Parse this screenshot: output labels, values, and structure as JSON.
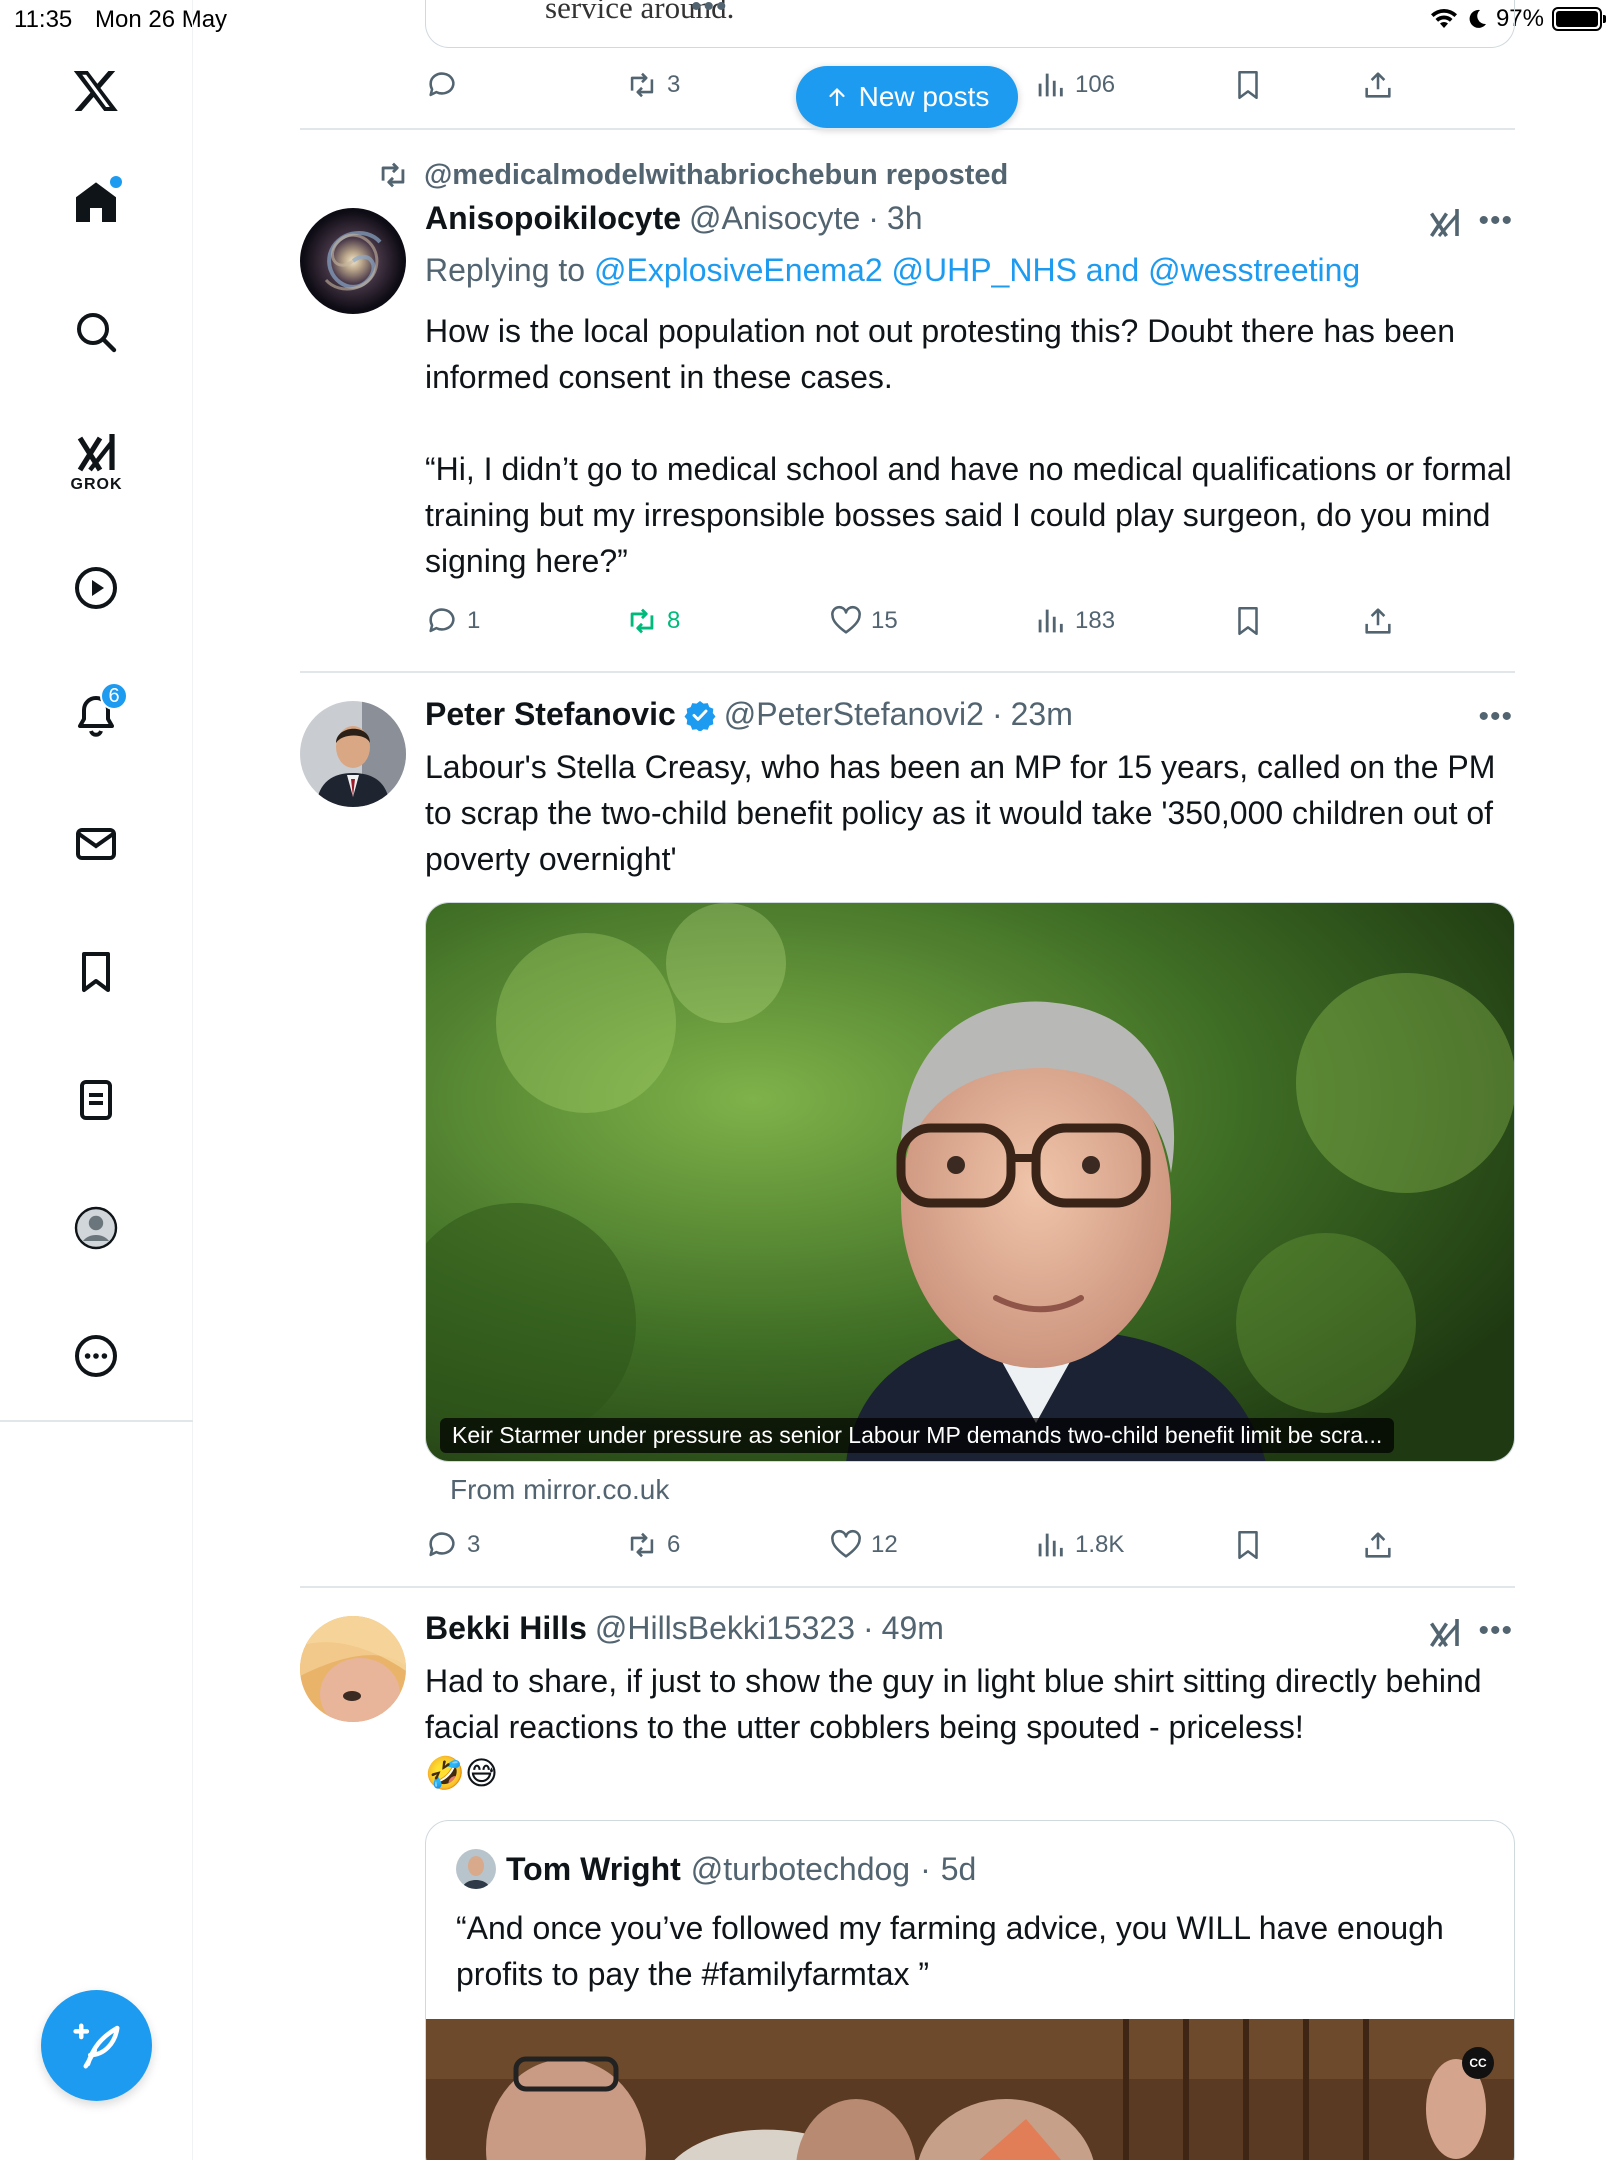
{
  "status_bar": {
    "time": "11:35",
    "date": "Mon 26 May",
    "battery": "97%"
  },
  "sidebar": {
    "items": [
      {
        "icon": "x-logo-icon"
      },
      {
        "icon": "home-icon",
        "has_dot": true
      },
      {
        "icon": "search-icon"
      },
      {
        "icon": "grok-icon",
        "label": "GROK"
      },
      {
        "icon": "video-play-icon"
      },
      {
        "icon": "notifications-bell-icon",
        "badge": "6"
      },
      {
        "icon": "messages-envelope-icon"
      },
      {
        "icon": "bookmarks-icon"
      },
      {
        "icon": "lists-icon"
      },
      {
        "icon": "profile-avatar-icon"
      },
      {
        "icon": "more-circle-icon"
      }
    ],
    "compose_icon": "compose-feather-icon"
  },
  "new_posts_pill": {
    "label": "New posts"
  },
  "top_card": {
    "text": "service around.",
    "dots": "•••",
    "actions": {
      "replies": "",
      "reposts": "3",
      "views": "106"
    }
  },
  "posts": [
    {
      "social_context": "@medicalmodelwithabriochebun reposted",
      "name": "Anisopoikilocyte",
      "handle": "@Anisocyte",
      "time": "3h",
      "replying_prefix": "Replying to",
      "replying_to": "@ExplosiveEnema2 @UHP_NHS and @wesstreeting",
      "text": "How is the local population not out protesting this? Doubt there has been informed consent in these cases.\n\n“Hi, I didn’t go to medical school and have no medical qualifications or formal training but my irresponsible bosses said I could play surgeon, do you mind signing here?”",
      "actions": {
        "replies": "1",
        "reposts": "8",
        "likes": "15",
        "views": "183"
      }
    },
    {
      "name": "Peter Stefanovic",
      "handle": "@PeterStefanovi2",
      "time": "23m",
      "text": "Labour's Stella Creasy, who has been an MP for 15 years, called on the PM to scrap the two-child benefit policy as it would take '350,000 children out of poverty overnight'",
      "media_caption": "Keir Starmer under pressure as senior Labour MP demands two-child benefit limit be scra...",
      "media_source": "From mirror.co.uk",
      "actions": {
        "replies": "3",
        "reposts": "6",
        "likes": "12",
        "views": "1.8K"
      }
    },
    {
      "name": "Bekki Hills",
      "handle": "@HillsBekki15323",
      "time": "49m",
      "text": "Had to share, if just to show the guy in light blue shirt sitting directly behind facial reactions to the utter cobblers being spouted - priceless!",
      "emoji": "🤣😅",
      "quote": {
        "name": "Tom Wright",
        "handle": "@turbotechdog",
        "time": "5d",
        "text": "“And once you’ve followed my farming advice, you WILL have enough profits to pay the #familyfarmtax ”",
        "cc": "CC"
      }
    }
  ],
  "colors": {
    "accent": "#1d9bf0",
    "repost_active": "#00ba7c",
    "secondary_text": "#536471",
    "divider": "#e1e6e8"
  }
}
